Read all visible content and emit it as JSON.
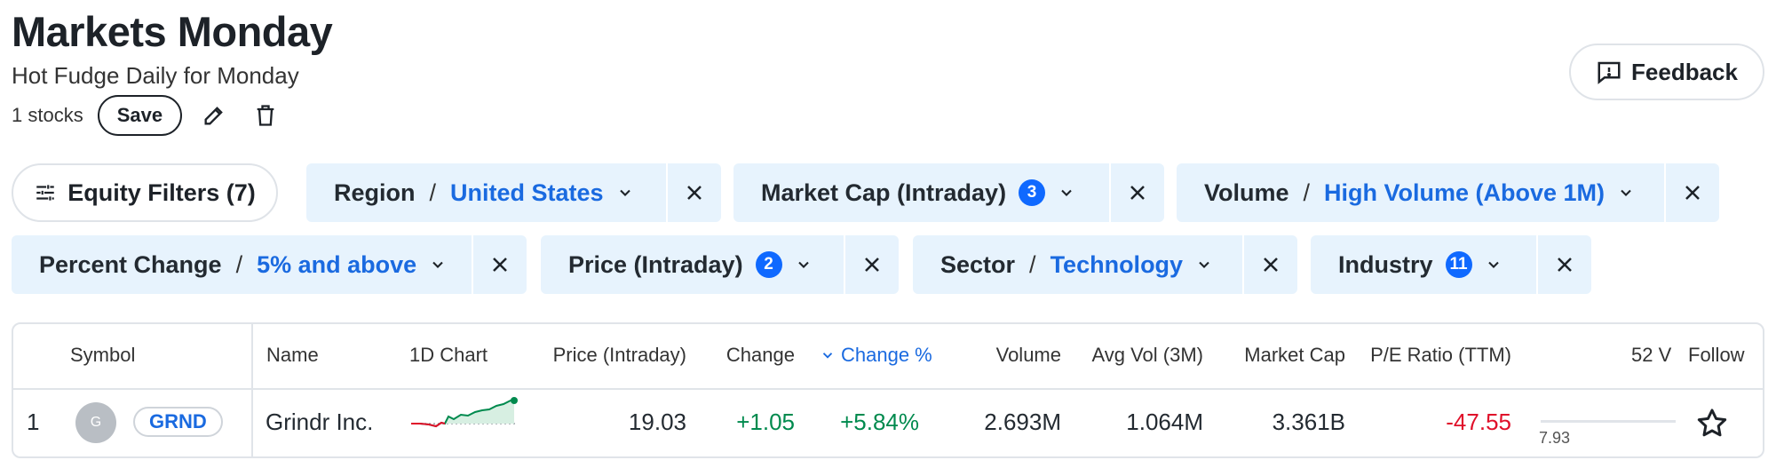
{
  "header": {
    "title": "Markets Monday",
    "subtitle": "Hot Fudge Daily for Monday",
    "stock_count": "1 stocks",
    "save_label": "Save"
  },
  "feedback_label": "Feedback",
  "filters": {
    "equity_label": "Equity Filters (7)",
    "chips": [
      {
        "label": "Region",
        "value": "United States"
      },
      {
        "label": "Market Cap (Intraday)",
        "badge": "3"
      },
      {
        "label": "Volume",
        "value": "High Volume (Above 1M)"
      },
      {
        "label": "Percent Change",
        "value": "5% and above"
      },
      {
        "label": "Price (Intraday)",
        "badge": "2"
      },
      {
        "label": "Sector",
        "value": "Technology"
      },
      {
        "label": "Industry",
        "badge": "11"
      }
    ],
    "separator": "/"
  },
  "table": {
    "columns": [
      "Symbol",
      "Name",
      "1D Chart",
      "Price (Intraday)",
      "Change",
      "Change %",
      "Volume",
      "Avg Vol (3M)",
      "Market Cap",
      "P/E Ratio (TTM)",
      "52 V",
      "Follow"
    ],
    "sorted_column": "Change %",
    "rows": [
      {
        "index": "1",
        "avatar": "G",
        "symbol": "GRND",
        "name": "Grindr Inc.",
        "price": "19.03",
        "change": "+1.05",
        "change_pct": "+5.84%",
        "volume": "2.693M",
        "avg_vol": "1.064M",
        "market_cap": "3.361B",
        "pe_ratio": "-47.55",
        "range_low": "7.93"
      }
    ]
  },
  "colors": {
    "accent": "#1a6ae0",
    "chip_bg": "#e7f3fd",
    "badge": "#0f69ff",
    "positive": "#008a4e",
    "negative": "#e0102a"
  },
  "icons": [
    "edit-icon",
    "trash-icon",
    "feedback-icon",
    "sliders-icon",
    "chevron-down-icon",
    "close-icon",
    "sort-desc-icon",
    "star-icon"
  ]
}
